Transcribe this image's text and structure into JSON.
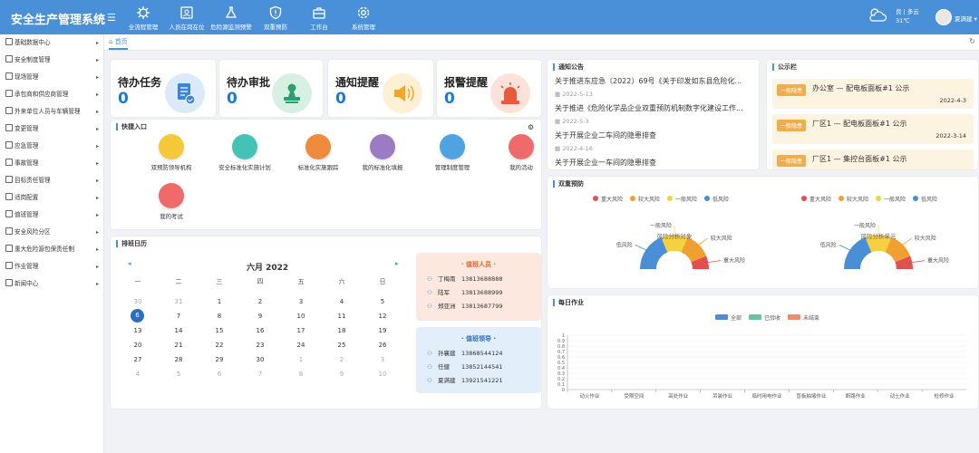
{
  "header": {
    "title": "安全生产管理系统",
    "nav": [
      {
        "label": "全流程管理",
        "icon": "process-gear-icon"
      },
      {
        "label": "人员在岗在位",
        "icon": "id-card-icon"
      },
      {
        "label": "危险源监测预警",
        "icon": "flask-icon"
      },
      {
        "label": "双重预防",
        "icon": "shield-alert-icon"
      },
      {
        "label": "工作台",
        "icon": "briefcase-icon"
      },
      {
        "label": "系统管理",
        "icon": "settings-icon"
      }
    ],
    "weather": {
      "text": "良 | 多云",
      "temp": "31℃"
    },
    "user": "夏满建"
  },
  "sidebar": {
    "items": [
      {
        "label": "基础数据中心"
      },
      {
        "label": "安全制度管理"
      },
      {
        "label": "现场管理"
      },
      {
        "label": "承包商和供应商管理"
      },
      {
        "label": "外来单位人员与车辆管理"
      },
      {
        "label": "变更管理"
      },
      {
        "label": "应急管理"
      },
      {
        "label": "事故管理"
      },
      {
        "label": "目标责任管理"
      },
      {
        "label": "适岗配置"
      },
      {
        "label": "值班管理"
      },
      {
        "label": "安全风险分区"
      },
      {
        "label": "重大危险源包保责任制"
      },
      {
        "label": "作业管理"
      },
      {
        "label": "新闻中心"
      }
    ]
  },
  "tabs": {
    "home": "首页"
  },
  "stats": [
    {
      "title": "待办任务",
      "value": "0",
      "color": "#dbeaf8"
    },
    {
      "title": "待办审批",
      "value": "0",
      "color": "#d8efe4"
    },
    {
      "title": "通知提醒",
      "value": "0",
      "color": "#fdf0d4"
    },
    {
      "title": "报警提醒",
      "value": "0",
      "color": "#fde2da"
    }
  ],
  "quick": {
    "title": "快捷入口",
    "items": [
      {
        "label": "双预防领导机构",
        "color": "#f5c83a"
      },
      {
        "label": "安全标准化实施计划",
        "color": "#44c2b4"
      },
      {
        "label": "标准化实施跟踪",
        "color": "#f08a3c"
      },
      {
        "label": "我的标准化填报",
        "color": "#9b7cc4"
      },
      {
        "label": "管理制度管理",
        "color": "#4fa3e0"
      },
      {
        "label": "我的活动",
        "color": "#ef6b6b"
      },
      {
        "label": "我的考试",
        "color": "#ef6b6b"
      }
    ]
  },
  "schedule": {
    "title": "排班日历",
    "month": "六月 2022",
    "weekdays": [
      "一",
      "二",
      "三",
      "四",
      "五",
      "六",
      "日"
    ],
    "rows": [
      [
        "30",
        "31",
        "1",
        "2",
        "3",
        "4",
        "5"
      ],
      [
        "6",
        "7",
        "8",
        "9",
        "10",
        "11",
        "12"
      ],
      [
        "13",
        "14",
        "15",
        "16",
        "17",
        "18",
        "19"
      ],
      [
        "20",
        "21",
        "22",
        "23",
        "24",
        "25",
        "26"
      ],
      [
        "27",
        "28",
        "29",
        "30",
        "1",
        "2",
        "3"
      ],
      [
        "4",
        "5",
        "6",
        "7",
        "8",
        "9",
        "10"
      ]
    ],
    "duty_staff": {
      "title": "· 值班人员 ·",
      "people": [
        {
          "name": "丁梅南",
          "phone": "13813688888"
        },
        {
          "name": "陆军",
          "phone": "13813688999"
        },
        {
          "name": "郑亚洲",
          "phone": "13813687799"
        }
      ]
    },
    "duty_leaders": {
      "title": "· 值班领导 ·",
      "people": [
        {
          "name": "孙襄建",
          "phone": "13868544124"
        },
        {
          "name": "任健",
          "phone": "13852144541"
        },
        {
          "name": "夏满建",
          "phone": "13921541221"
        }
      ]
    }
  },
  "notices": {
    "title": "通知公告",
    "items": [
      {
        "text": "关于推进东应急〔2022〕69号《关于印发如东县危险化...",
        "date": "2022-5-13"
      },
      {
        "text": "关于推进《危险化学品企业双重预防机制数字化建设工作...",
        "date": "2022-5-3"
      },
      {
        "text": "关于开展企业二车间的隐患排查",
        "date": "2022-4-16"
      },
      {
        "text": "关于开展企业一车间的隐患排查",
        "date": ""
      }
    ]
  },
  "public_board": {
    "title": "公示栏",
    "items": [
      {
        "badge": "一般隐患",
        "text": "办公室 — 配电板面板#1 公示",
        "date": "2022-4-3"
      },
      {
        "badge": "一般隐患",
        "text": "厂区1 — 配电板面板#1 公示",
        "date": "2022-3-14"
      },
      {
        "badge": "一般隐患",
        "text": "厂区1 — 集控台面板#1 公示",
        "date": ""
      }
    ]
  },
  "dual_prevention": {
    "title": "双重预防",
    "legend": [
      "重大风险",
      "较大风险",
      "一般风险",
      "低风险"
    ],
    "colors": [
      "#e05050",
      "#f0a030",
      "#f5d040",
      "#4a8fd6"
    ]
  },
  "daily_work": {
    "title": "每日作业",
    "legend": [
      "全部",
      "已验收",
      "未结束"
    ],
    "colors": [
      "#4a8fd6",
      "#6cc3a0",
      "#f08a6c"
    ]
  },
  "chart_data": [
    {
      "type": "pie",
      "title": "风险分析对象",
      "categories": [
        "重大风险",
        "较大风险",
        "一般风险",
        "低风险"
      ],
      "values": [
        0.5,
        1,
        1,
        1.5
      ],
      "labels": [
        "重大风险",
        "较大风险",
        "一般风险",
        "低风险"
      ]
    },
    {
      "type": "pie",
      "title": "风险分析单元",
      "categories": [
        "重大风险",
        "较大风险",
        "一般风险",
        "低风险"
      ],
      "values": [
        0.5,
        1,
        1,
        1.5
      ],
      "labels": [
        "重大风险",
        "较大风险",
        "一般风险",
        "低风险"
      ]
    },
    {
      "type": "bar",
      "categories": [
        "动火作业",
        "受限空间",
        "高处作业",
        "吊装作业",
        "临时用电作业",
        "盲板抽堵作业",
        "断路作业",
        "动土作业",
        "检修作业"
      ],
      "series": [
        {
          "name": "全部",
          "values": [
            0,
            0,
            0,
            0,
            0,
            0,
            0,
            0,
            0
          ]
        },
        {
          "name": "已验收",
          "values": [
            0,
            0,
            0,
            0,
            0,
            0,
            0,
            0,
            0
          ]
        },
        {
          "name": "未结束",
          "values": [
            0,
            0,
            0,
            0,
            0,
            0,
            0,
            0,
            0
          ]
        }
      ],
      "ylim": [
        0,
        1
      ],
      "yticks": [
        "0",
        "0.1",
        "0.2",
        "0.3",
        "0.4",
        "0.5",
        "0.6",
        "0.7",
        "0.8",
        "0.9",
        "1"
      ]
    }
  ]
}
